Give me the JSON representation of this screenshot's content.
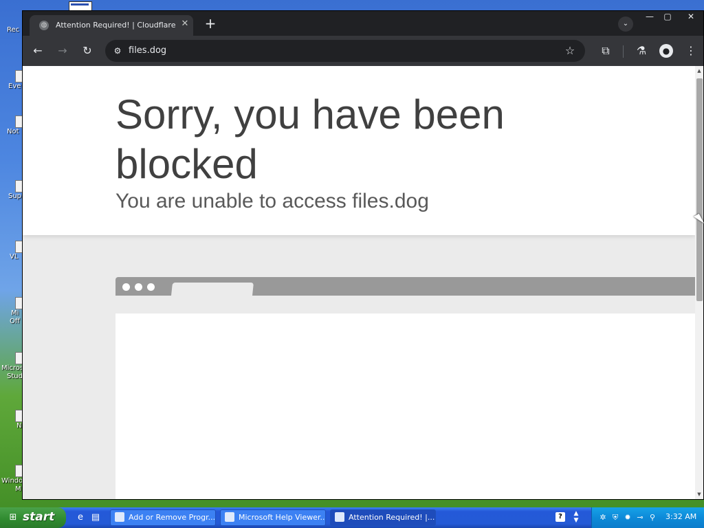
{
  "desktop": {
    "icons": [
      {
        "label": "Rec"
      },
      {
        "label": "Eve"
      },
      {
        "label": "Not"
      },
      {
        "label": "Sup"
      },
      {
        "label": "VL"
      },
      {
        "label": "Mi"
      },
      {
        "label": "Off"
      },
      {
        "label": "Micros"
      },
      {
        "label": "Stud"
      },
      {
        "label": "N"
      },
      {
        "label": "Windo"
      },
      {
        "label": "M"
      }
    ]
  },
  "browser": {
    "tab": {
      "title": "Attention Required! | Cloudflare",
      "close": "✕",
      "favicon": "globe-icon"
    },
    "new_tab": "+",
    "tab_search": "⌄",
    "window_controls": {
      "minimize": "—",
      "maximize": "▢",
      "close": "✕"
    },
    "toolbar": {
      "back": "←",
      "forward": "→",
      "reload": "↻",
      "site_info": "⚙",
      "url": "files.dog",
      "bookmark": "☆",
      "extensions": "⧉",
      "labs": "⚗",
      "profile": "●",
      "menu": "⋮"
    }
  },
  "page": {
    "headline": "Sorry, you have been blocked",
    "subline": "You are unable to access files.dog"
  },
  "taskbar": {
    "start_label": "start",
    "start_flag": "⊞",
    "quick_launch": [
      "e",
      "▤"
    ],
    "tasks": [
      {
        "label": "Add or Remove Progr..."
      },
      {
        "label": "Microsoft Help Viewer..."
      },
      {
        "label": "Attention Required! |..."
      }
    ],
    "help_icon": "?",
    "tray_icons": [
      "✲",
      "⛨",
      "✹",
      "⊸",
      "⚲"
    ],
    "clock": "3:32 AM"
  },
  "colors": {
    "headline": "#404040",
    "subline": "#595959",
    "chrome_dark": "#202124",
    "chrome_toolbar": "#35363a",
    "taskbar_blue": "#245ad6",
    "start_green": "#2f8a2f"
  }
}
